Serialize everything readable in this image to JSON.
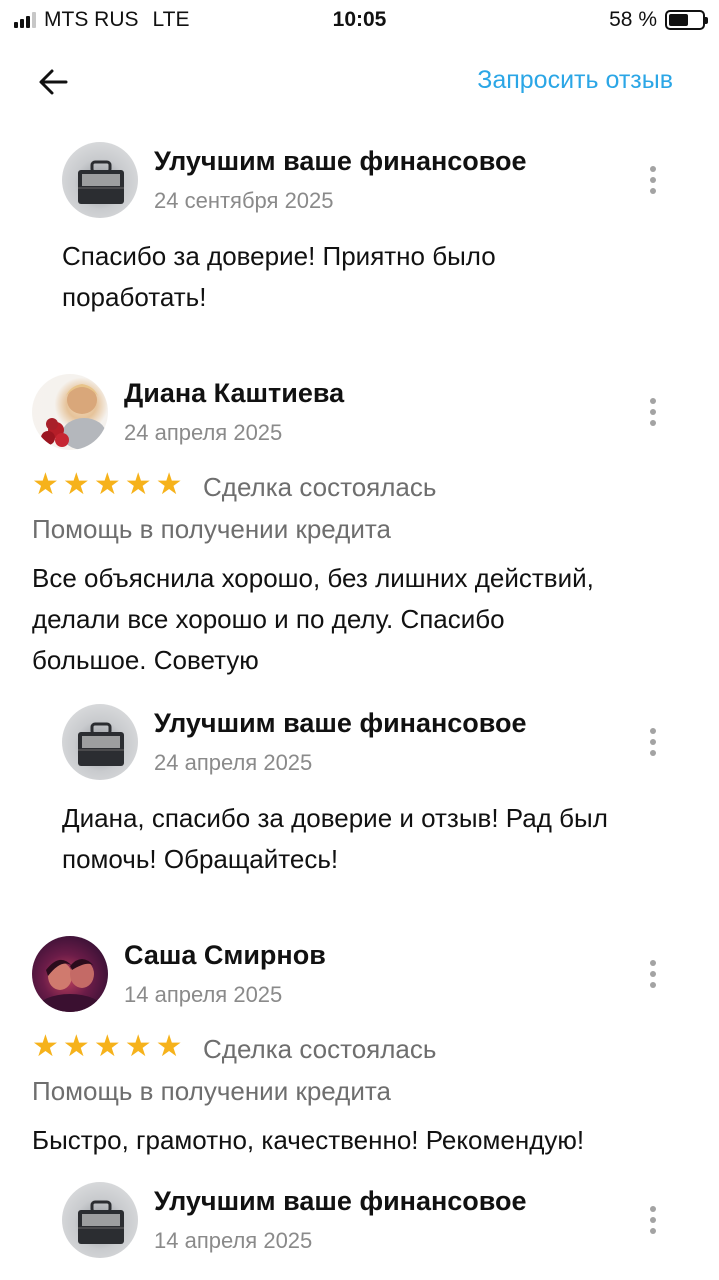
{
  "status_bar": {
    "carrier": "MTS RUS",
    "network": "LTE",
    "time": "10:05",
    "battery_text": "58 %",
    "battery_level": 0.58
  },
  "header": {
    "back_icon": "arrow-left-icon",
    "request_label": "Запросить отзыв",
    "accent_color": "#2ba6e6"
  },
  "reviews": [
    {
      "reply": {
        "name": "Улучшим ваше финансовое",
        "date": "24 сентября 2025",
        "text_lines": [
          "Спасибо за доверие! Приятно было",
          "поработать!"
        ]
      }
    },
    {
      "author": "Диана Каштиева",
      "date": "24 апреля 2025",
      "rating": 5,
      "stars": [
        "★",
        "★",
        "★",
        "★",
        "★"
      ],
      "deal": "Сделка состоялась",
      "service": "Помощь в получении кредита",
      "text_lines": [
        "Все объяснила хорошо, без лишних действий,",
        "делали все хорошо и по делу. Спасибо",
        "большое. Советую"
      ],
      "reply": {
        "name": "Улучшим ваше финансовое",
        "date": "24 апреля 2025",
        "text_lines": [
          "Диана, спасибо за доверие и отзыв! Рад был",
          "помочь! Обращайтесь!"
        ]
      }
    },
    {
      "author": "Саша Смирнов",
      "date": "14 апреля 2025",
      "rating": 5,
      "stars": [
        "★",
        "★",
        "★",
        "★",
        "★"
      ],
      "deal": "Сделка состоялась",
      "service": "Помощь в получении кредита",
      "text_lines": [
        "Быстро, грамотно, качественно! Рекомендую!"
      ],
      "reply": {
        "name": "Улучшим ваше финансовое",
        "date": "14 апреля 2025"
      }
    }
  ],
  "colors": {
    "star": "#f6b21b",
    "secondary_text": "#6e6e6e",
    "date_text": "#8a8a8a"
  }
}
